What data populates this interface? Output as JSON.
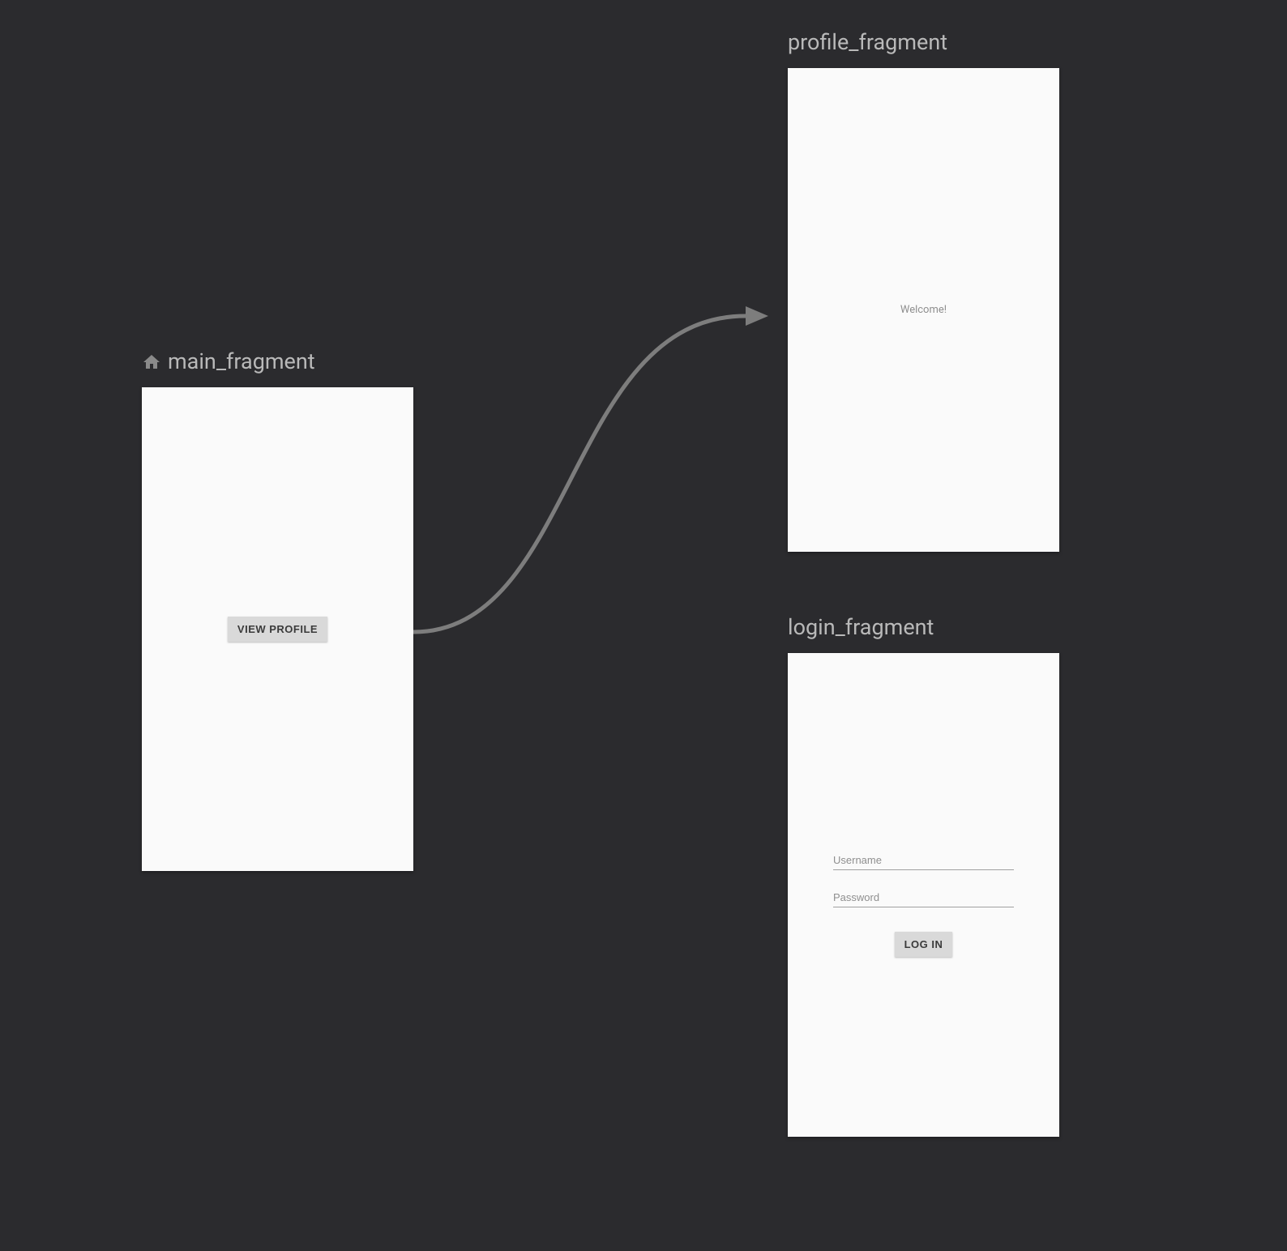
{
  "fragments": {
    "main": {
      "label": "main_fragment",
      "button": "VIEW PROFILE"
    },
    "profile": {
      "label": "profile_fragment",
      "text": "Welcome!"
    },
    "login": {
      "label": "login_fragment",
      "username_placeholder": "Username",
      "password_placeholder": "Password",
      "button": "LOG IN"
    }
  }
}
